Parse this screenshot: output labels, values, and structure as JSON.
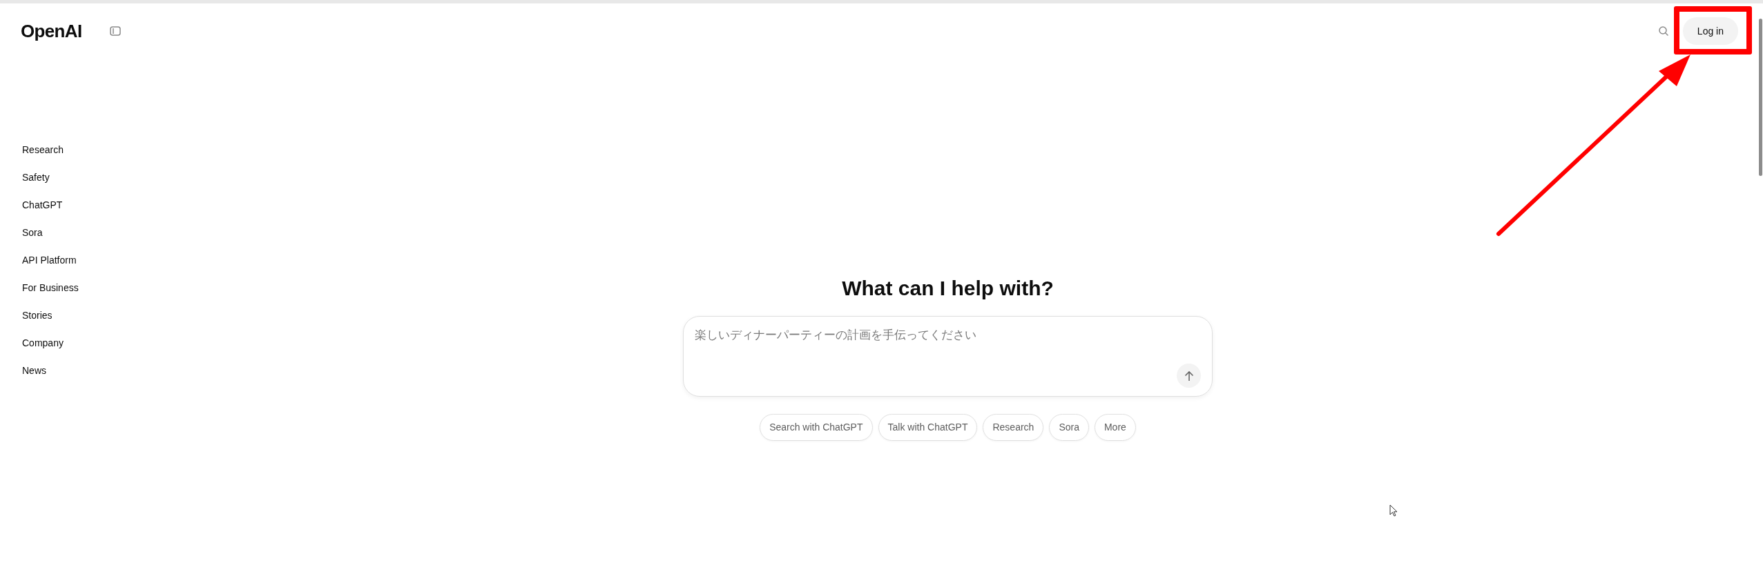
{
  "header": {
    "logo": "OpenAI",
    "login_button": "Log in"
  },
  "sidebar": {
    "items": [
      "Research",
      "Safety",
      "ChatGPT",
      "Sora",
      "API Platform",
      "For Business",
      "Stories",
      "Company",
      "News"
    ]
  },
  "main": {
    "heading": "What can I help with?",
    "prompt": {
      "placeholder": "楽しいディナーパーティーの計画を手伝ってください"
    },
    "chips": [
      "Search with ChatGPT",
      "Talk with ChatGPT",
      "Research",
      "Sora",
      "More"
    ]
  }
}
